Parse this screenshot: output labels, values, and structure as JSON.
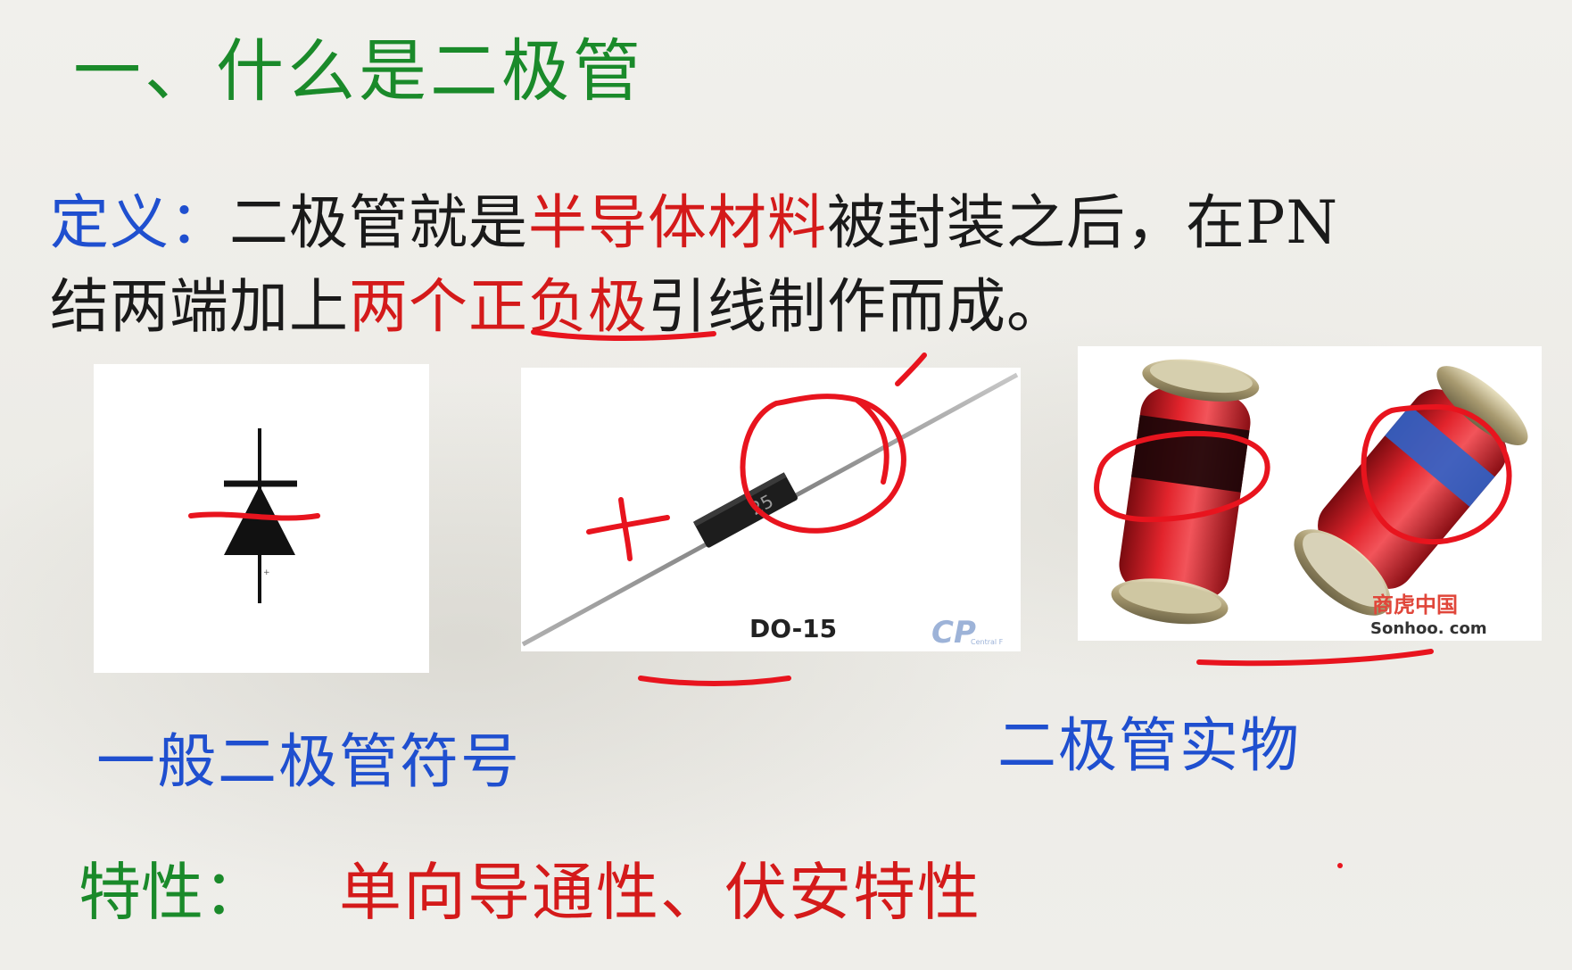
{
  "title": "一、什么是二极管",
  "definition": {
    "label": "定义：",
    "seg1": "二极管就是",
    "seg2": "半导体材料",
    "seg3": "被封装之后，在PN",
    "seg4": "结两端加上",
    "seg5": "两个正负极",
    "seg6": "引线制作而成。"
  },
  "images": {
    "symbol": {
      "alt": "一般二极管符号"
    },
    "axial": {
      "package_label": "DO-15",
      "body_marking": "25",
      "watermark": "Central F"
    },
    "smd": {
      "watermark_cn": "商虎中国",
      "watermark_en": "Sonhoo. com"
    }
  },
  "captions": {
    "symbol": "一般二极管符号",
    "real": "二极管实物"
  },
  "properties": {
    "label": "特性：",
    "value": "单向导通性、伏安特性"
  },
  "annotations": {
    "plus_mark": "+",
    "minus_mark": "-"
  },
  "colors": {
    "title_green": "#1a8a2a",
    "definition_blue": "#1f4fcf",
    "highlight_red": "#d41a1a",
    "ink_red": "#e8141e"
  }
}
